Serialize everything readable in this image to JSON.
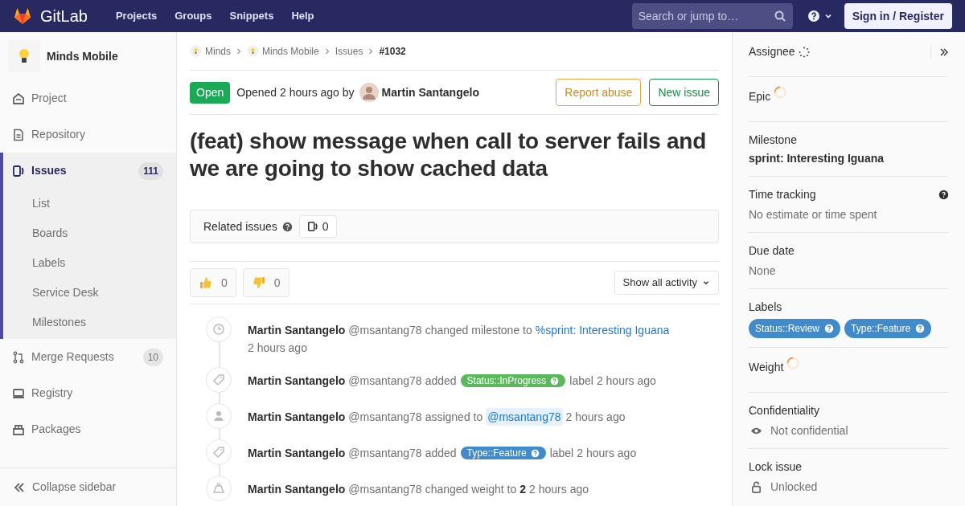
{
  "navbar": {
    "brand": "GitLab",
    "links": [
      "Projects",
      "Groups",
      "Snippets",
      "Help"
    ],
    "search": {
      "placeholder": "Search or jump to…"
    },
    "sign_in": "Sign in / Register"
  },
  "sidebar": {
    "project": "Minds Mobile",
    "items": [
      {
        "label": "Project",
        "kind": "home",
        "selected": false
      },
      {
        "label": "Repository",
        "kind": "doc",
        "selected": false
      },
      {
        "label": "Issues",
        "kind": "issues",
        "count": "111",
        "selected": true,
        "children": [
          {
            "label": "List"
          },
          {
            "label": "Boards"
          },
          {
            "label": "Labels"
          },
          {
            "label": "Service Desk"
          },
          {
            "label": "Milestones"
          }
        ]
      },
      {
        "label": "Merge Requests",
        "kind": "merge",
        "count": "10",
        "selected": false
      },
      {
        "label": "Registry",
        "kind": "registry",
        "selected": false
      },
      {
        "label": "Packages",
        "kind": "package",
        "selected": false
      }
    ],
    "collapse": "Collapse sidebar"
  },
  "breadcrumbs": [
    "Minds",
    "Minds Mobile",
    "Issues",
    "#1032"
  ],
  "issue": {
    "status": "Open",
    "opened": "Opened 2 hours ago by",
    "author": "Martin Santangelo",
    "actions": [
      "Report abuse",
      "New issue"
    ],
    "title": "(feat) show message when call to server fails and we are going to show cached data",
    "related": {
      "label": "Related issues",
      "count": "0"
    },
    "awards": [
      {
        "kind": "thumbsup",
        "count": "0"
      },
      {
        "kind": "thumbsdown",
        "count": "0"
      }
    ],
    "activity_filter": "Show all activity"
  },
  "activity": [
    {
      "kind": "milestone",
      "author": "Martin Santangelo",
      "handle": "@msantang78",
      "parts": [
        {
          "kind": "text",
          "text": "changed milestone to"
        },
        {
          "kind": "link",
          "text": "%sprint: Interesting Iguana"
        }
      ],
      "time": "2 hours ago"
    },
    {
      "kind": "label",
      "author": "Martin Santangelo",
      "handle": "@msantang78",
      "parts": [
        {
          "kind": "text",
          "text": "added"
        },
        {
          "kind": "tag",
          "text": "Status::InProgress",
          "color": "#5cb85c"
        },
        {
          "kind": "text",
          "text": "label"
        }
      ],
      "time": "2 hours ago"
    },
    {
      "kind": "assignee",
      "author": "Martin Santangelo",
      "handle": "@msantang78",
      "parts": [
        {
          "kind": "text",
          "text": "assigned to"
        },
        {
          "kind": "mention",
          "text": "@msantang78"
        }
      ],
      "time": "2 hours ago"
    },
    {
      "kind": "label",
      "author": "Martin Santangelo",
      "handle": "@msantang78",
      "parts": [
        {
          "kind": "text",
          "text": "added"
        },
        {
          "kind": "tag",
          "text": "Type::Feature",
          "color": "#428bca"
        },
        {
          "kind": "text",
          "text": "label"
        }
      ],
      "time": "2 hours ago"
    },
    {
      "kind": "weight",
      "author": "Martin Santangelo",
      "handle": "@msantang78",
      "parts": [
        {
          "kind": "text",
          "text": "changed weight to"
        },
        {
          "kind": "bold",
          "text": "2"
        }
      ],
      "time": "2 hours ago"
    }
  ],
  "right_sidebar": [
    {
      "kind": "loading",
      "title": "Assignee",
      "collapse": true
    },
    {
      "kind": "loading",
      "title": "Epic"
    },
    {
      "kind": "strong",
      "title": "Milestone",
      "value": "sprint: Interesting Iguana"
    },
    {
      "kind": "help",
      "title": "Time tracking",
      "value": "No estimate or time spent"
    },
    {
      "kind": "muted",
      "title": "Due date",
      "value": "None"
    },
    {
      "kind": "labels",
      "title": "Labels",
      "labels": [
        {
          "text": "Status::Review",
          "color": "#428bca"
        },
        {
          "text": "Type::Feature",
          "color": "#428bca"
        }
      ]
    },
    {
      "kind": "loading",
      "title": "Weight"
    },
    {
      "kind": "eye",
      "title": "Confidentiality",
      "value": "Not confidential"
    },
    {
      "kind": "lock",
      "title": "Lock issue",
      "value": "Unlocked"
    }
  ]
}
